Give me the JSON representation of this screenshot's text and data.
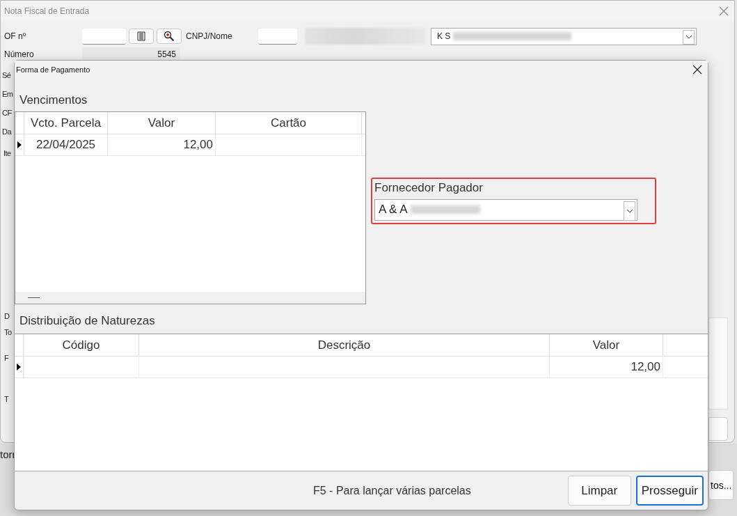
{
  "main_window": {
    "title": "Nota Fiscal de Entrada",
    "of_label": "OF nº",
    "cnpj_label": "CNPJ/Nome",
    "numero_label": "Número",
    "numero_value": "5545",
    "supplier_value": "K S",
    "partial_labels": [
      "Sé",
      "Em",
      "CF",
      "Da"
    ],
    "tab_label": "Ite",
    "lower_labels": [
      "D",
      "To",
      "F",
      "T"
    ]
  },
  "background_app": {
    "label": "torr",
    "button": "tos..."
  },
  "dialog": {
    "title": "Forma de Pagamento",
    "vencimentos": {
      "title": "Vencimentos",
      "columns": [
        "Vcto. Parcela",
        "Valor",
        "Cartão"
      ],
      "rows": [
        {
          "vcto": "22/04/2025",
          "valor": "12,00",
          "current": true
        }
      ]
    },
    "payer": {
      "label": "Fornecedor Pagador",
      "value": "A & A",
      "highlighted": true
    },
    "naturezas": {
      "title": "Distribuição de Naturezas",
      "columns": [
        "Código",
        "Descrição",
        "Valor"
      ],
      "rows": [
        {
          "valor": "12,00",
          "current": true
        }
      ]
    },
    "hint": "F5 - Para lançar várias parcelas",
    "buttons": [
      {
        "label": "Limpar",
        "focused": false
      },
      {
        "label": "Prosseguir",
        "focused": true
      }
    ]
  }
}
